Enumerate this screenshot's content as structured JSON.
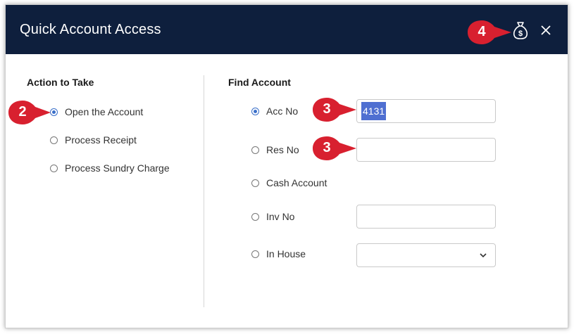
{
  "dialog": {
    "title": "Quick Account Access",
    "close_icon": "close-icon",
    "money_icon": "money-bag-icon"
  },
  "action": {
    "heading": "Action to Take",
    "options": [
      {
        "label": "Open the Account",
        "checked": true
      },
      {
        "label": "Process Receipt",
        "checked": false
      },
      {
        "label": "Process Sundry Charge",
        "checked": false
      }
    ]
  },
  "find": {
    "heading": "Find Account",
    "options": [
      {
        "label": "Acc No",
        "checked": true
      },
      {
        "label": "Res No",
        "checked": false
      },
      {
        "label": "Cash Account",
        "checked": false
      },
      {
        "label": "Inv No",
        "checked": false
      },
      {
        "label": "In House",
        "checked": false
      }
    ],
    "acc_no_value": "4131",
    "res_no_value": "",
    "inv_no_value": "",
    "in_house_value": ""
  },
  "callouts": {
    "c2": "2",
    "c3a": "3",
    "c3b": "3",
    "c4": "4"
  },
  "colors": {
    "header": "#0e1f3d",
    "callout": "#d8202f",
    "accent": "#3a6fc9",
    "selection": "#4f6fd1"
  }
}
